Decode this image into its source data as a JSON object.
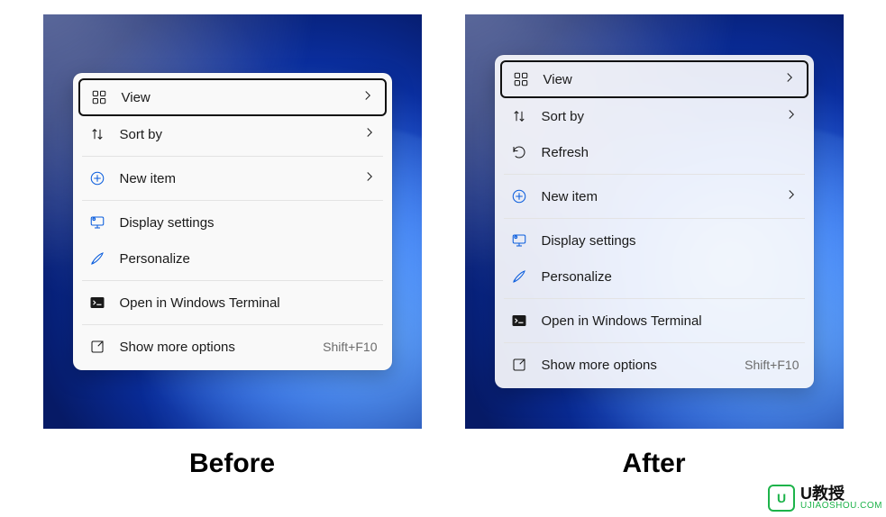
{
  "captions": {
    "before": "Before",
    "after": "After"
  },
  "menus": {
    "before": {
      "groups": [
        [
          {
            "id": "view",
            "label": "View",
            "icon": "grid-icon",
            "submenu": true,
            "highlighted": true
          },
          {
            "id": "sort-by",
            "label": "Sort by",
            "icon": "sort-icon",
            "submenu": true
          }
        ],
        [
          {
            "id": "new-item",
            "label": "New item",
            "icon": "plus-circle-icon",
            "submenu": true,
            "iconColor": "blue"
          }
        ],
        [
          {
            "id": "display-settings",
            "label": "Display settings",
            "icon": "monitor-gear-icon",
            "iconColor": "blue"
          },
          {
            "id": "personalize",
            "label": "Personalize",
            "icon": "brush-icon",
            "iconColor": "blue"
          }
        ],
        [
          {
            "id": "open-terminal",
            "label": "Open in Windows Terminal",
            "icon": "terminal-icon",
            "iconFill": true
          }
        ],
        [
          {
            "id": "show-more",
            "label": "Show more options",
            "icon": "expand-icon",
            "shortcut": "Shift+F10"
          }
        ]
      ]
    },
    "after": {
      "groups": [
        [
          {
            "id": "view",
            "label": "View",
            "icon": "grid-icon",
            "submenu": true,
            "highlighted": true
          },
          {
            "id": "sort-by",
            "label": "Sort by",
            "icon": "sort-icon",
            "submenu": true
          },
          {
            "id": "refresh",
            "label": "Refresh",
            "icon": "refresh-icon"
          }
        ],
        [
          {
            "id": "new-item",
            "label": "New item",
            "icon": "plus-circle-icon",
            "submenu": true,
            "iconColor": "blue"
          }
        ],
        [
          {
            "id": "display-settings",
            "label": "Display settings",
            "icon": "monitor-gear-icon",
            "iconColor": "blue"
          },
          {
            "id": "personalize",
            "label": "Personalize",
            "icon": "brush-icon",
            "iconColor": "blue"
          }
        ],
        [
          {
            "id": "open-terminal",
            "label": "Open in Windows Terminal",
            "icon": "terminal-icon",
            "iconFill": true
          }
        ],
        [
          {
            "id": "show-more",
            "label": "Show more options",
            "icon": "expand-icon",
            "shortcut": "Shift+F10"
          }
        ]
      ]
    }
  },
  "watermark": {
    "badge": "U",
    "title": "U教授",
    "sub": "UJIAOSHOU.COM"
  }
}
